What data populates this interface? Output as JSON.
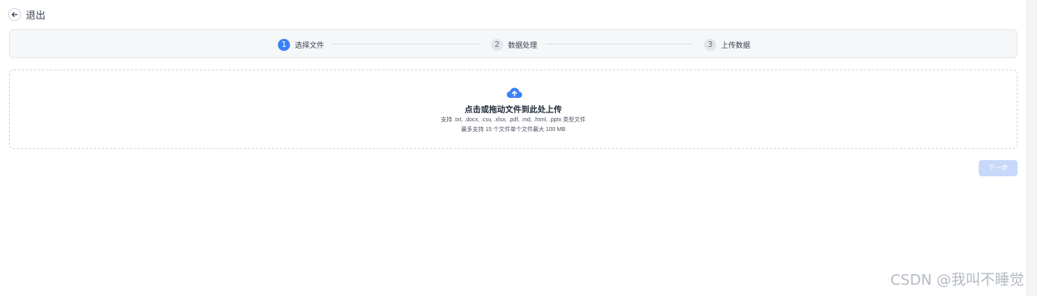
{
  "header": {
    "exit_label": "退出",
    "exit_icon": "arrow-left-icon"
  },
  "steps": [
    {
      "number": "1",
      "label": "选择文件",
      "state": "active"
    },
    {
      "number": "2",
      "label": "数据处理",
      "state": "inactive"
    },
    {
      "number": "3",
      "label": "上传数据",
      "state": "inactive"
    }
  ],
  "upload": {
    "icon": "cloud-upload-icon",
    "title": "点击或拖动文件到此处上传",
    "supported_types": "支持 .txt, .docx, .csv, .xlsx, .pdf, .md, .html, .pptx 类型文件",
    "limit": "最多支持 15 个文件单个文件最大 100 MB"
  },
  "actions": {
    "next_label": "下一步",
    "next_enabled": false
  },
  "watermark": "CSDN @我叫不睡觉",
  "colors": {
    "accent": "#3b82f6",
    "accent_disabled": "#c7d8fb",
    "step_inactive": "#e2e5ea",
    "steps_background": "#f6f7f9"
  }
}
